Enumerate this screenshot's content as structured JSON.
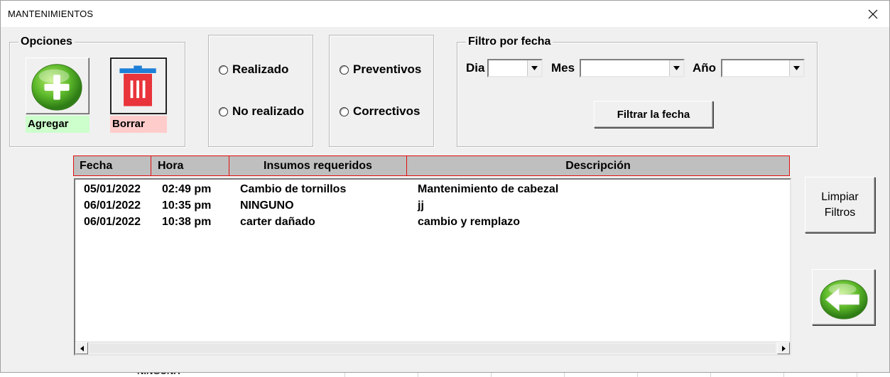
{
  "window": {
    "title": "MANTENIMIENTOS",
    "close_icon": "close-icon"
  },
  "opciones": {
    "legend": "Opciones",
    "agregar_label": "Agregar",
    "borrar_label": "Borrar",
    "agregar_color": "#ccffcc",
    "borrar_color": "#ffcccc"
  },
  "estado": {
    "realizado": "Realizado",
    "no_realizado": "No realizado"
  },
  "tipo": {
    "preventivos": "Preventivos",
    "correctivos": "Correctivos"
  },
  "filtro_fecha": {
    "legend": "Filtro por fecha",
    "dia_label": "Dia",
    "mes_label": "Mes",
    "ano_label": "Año",
    "dia_value": "",
    "mes_value": "",
    "ano_value": "",
    "filtrar_button": "Filtrar la fecha"
  },
  "table": {
    "headers": [
      "Fecha",
      "Hora",
      "Insumos requeridos",
      "Descripción"
    ],
    "rows": [
      [
        "05/01/2022",
        "02:49 pm",
        "Cambio de tornillos",
        "Mantenimiento de cabezal"
      ],
      [
        "06/01/2022",
        "10:35 pm",
        "NINGUNO",
        "jj"
      ],
      [
        "06/01/2022",
        "10:38 pm",
        "carter dañado",
        "cambio y remplazo"
      ]
    ]
  },
  "side": {
    "limpiar_line1": "Limpiar",
    "limpiar_line2": "Filtros",
    "back_icon": "back-arrow-icon"
  },
  "background": {
    "partial_text": "NINGUNA"
  }
}
